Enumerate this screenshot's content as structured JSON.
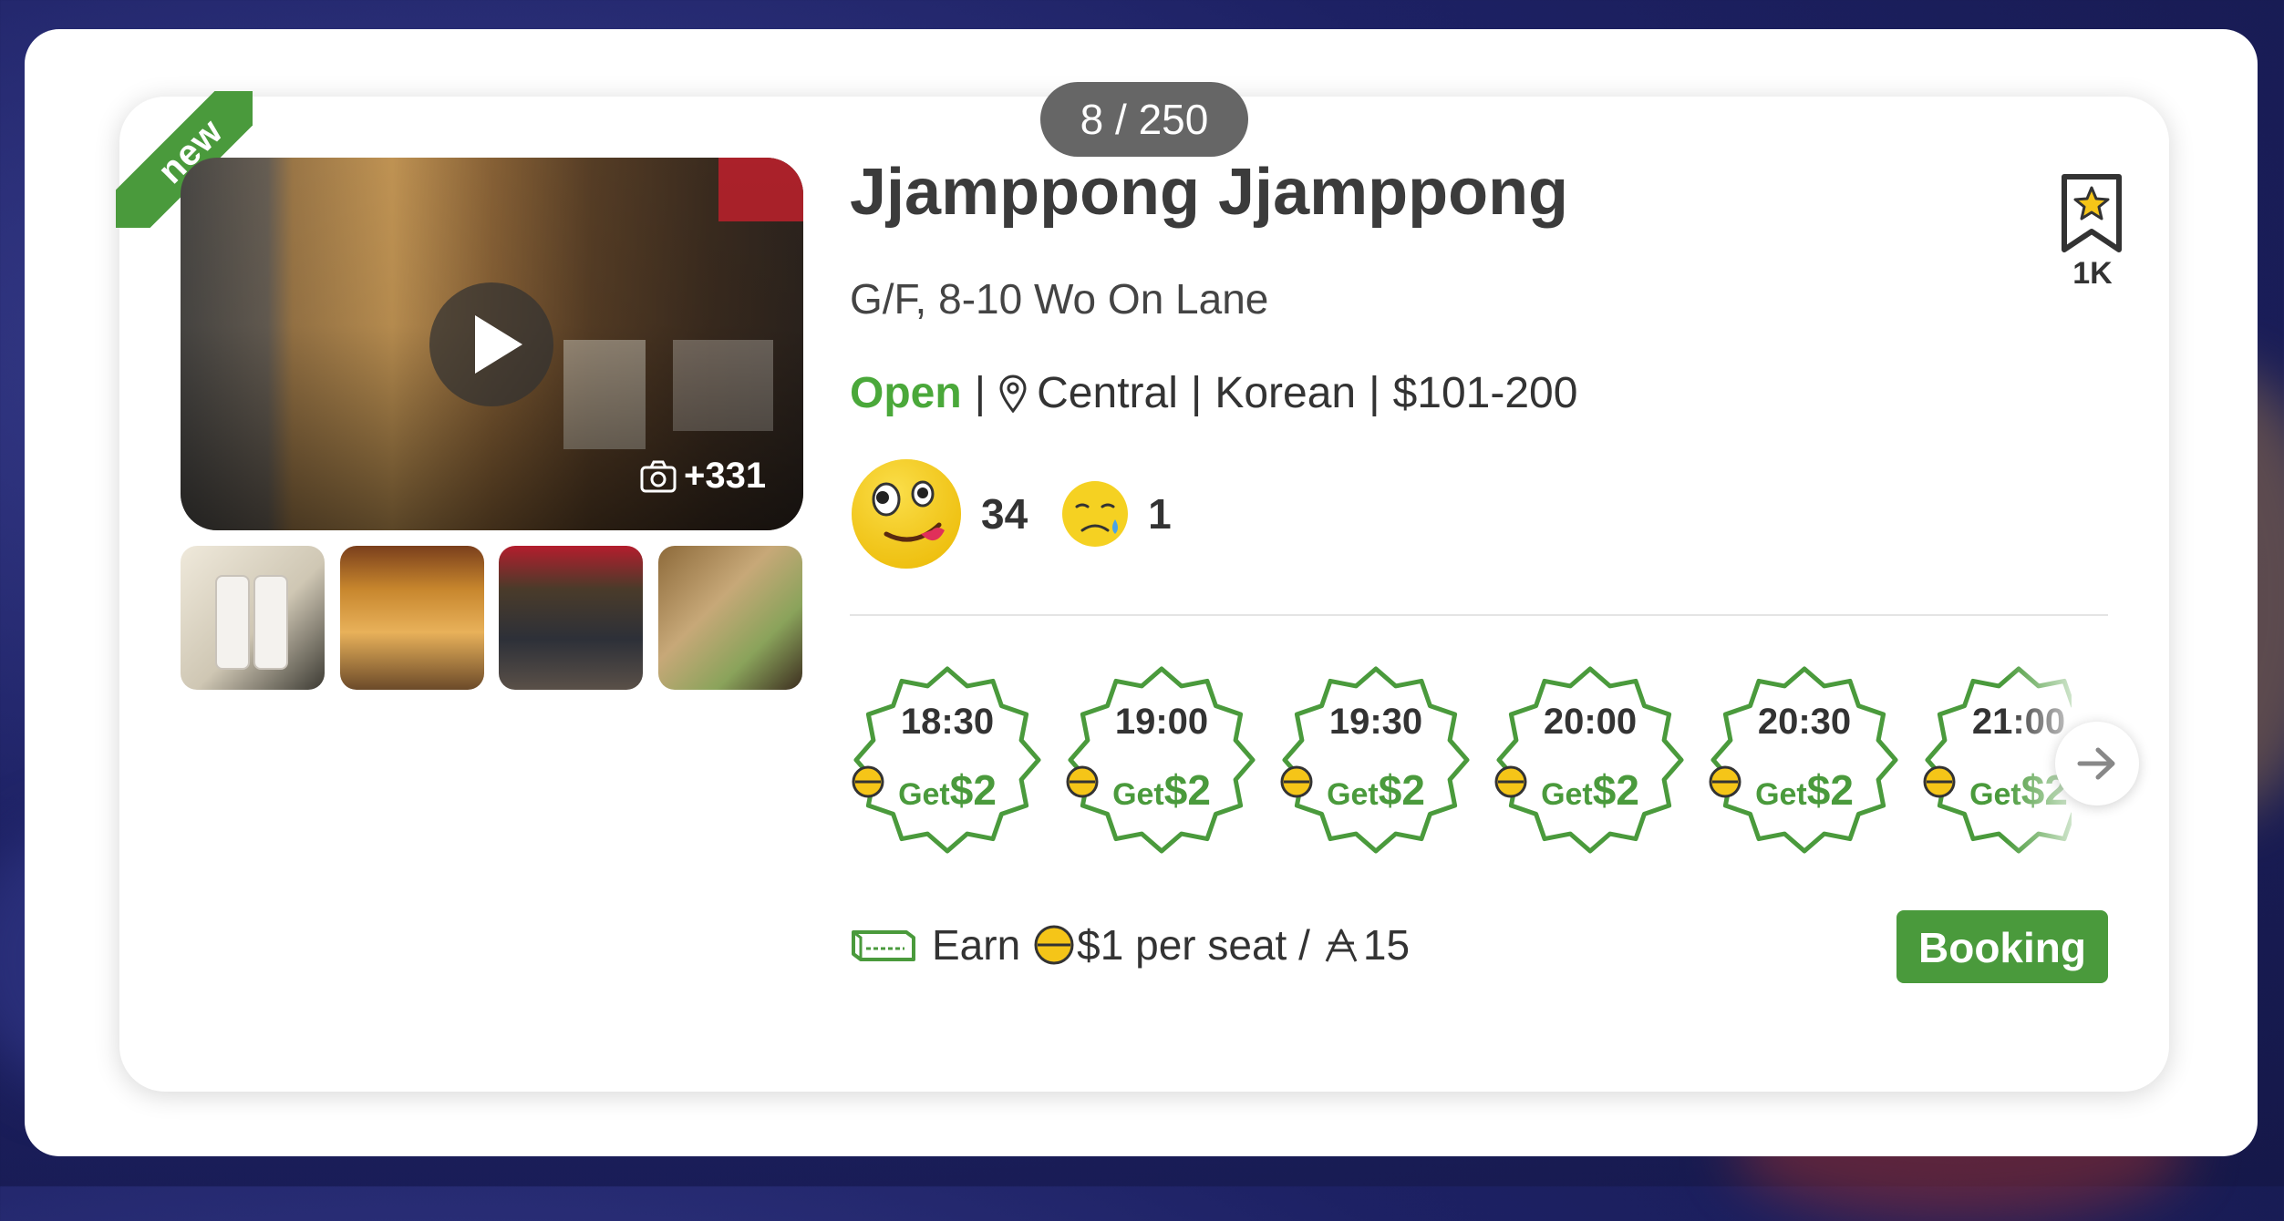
{
  "counter": "8 / 250",
  "ribbon": "new",
  "restaurant": {
    "name": "Jjamppong Jjamppong",
    "address": "G/F, 8-10 Wo On Lane",
    "status": "Open",
    "district": "Central",
    "cuisine": "Korean",
    "price_range": "$101-200"
  },
  "bookmark": {
    "count": "1K",
    "icon": "bookmark-star-icon"
  },
  "media": {
    "photo_count": "+331",
    "icon": "camera-icon"
  },
  "ratings": {
    "smile": "34",
    "cry": "1"
  },
  "timeslots": [
    {
      "time": "18:30",
      "get": "Get",
      "amount": "$2"
    },
    {
      "time": "19:00",
      "get": "Get",
      "amount": "$2"
    },
    {
      "time": "19:30",
      "get": "Get",
      "amount": "$2"
    },
    {
      "time": "20:00",
      "get": "Get",
      "amount": "$2"
    },
    {
      "time": "20:30",
      "get": "Get",
      "amount": "$2"
    },
    {
      "time": "21:00",
      "get": "Get",
      "amount": "$2"
    }
  ],
  "earn": {
    "label": "Earn",
    "amount": "$1 per seat /",
    "points": "15",
    "tag_icon": "reserved-tag-icon"
  },
  "booking_label": "Booking",
  "colors": {
    "accent_green": "#4a9a3c",
    "open_green": "#4aa83a",
    "counter_bg": "#666666"
  }
}
